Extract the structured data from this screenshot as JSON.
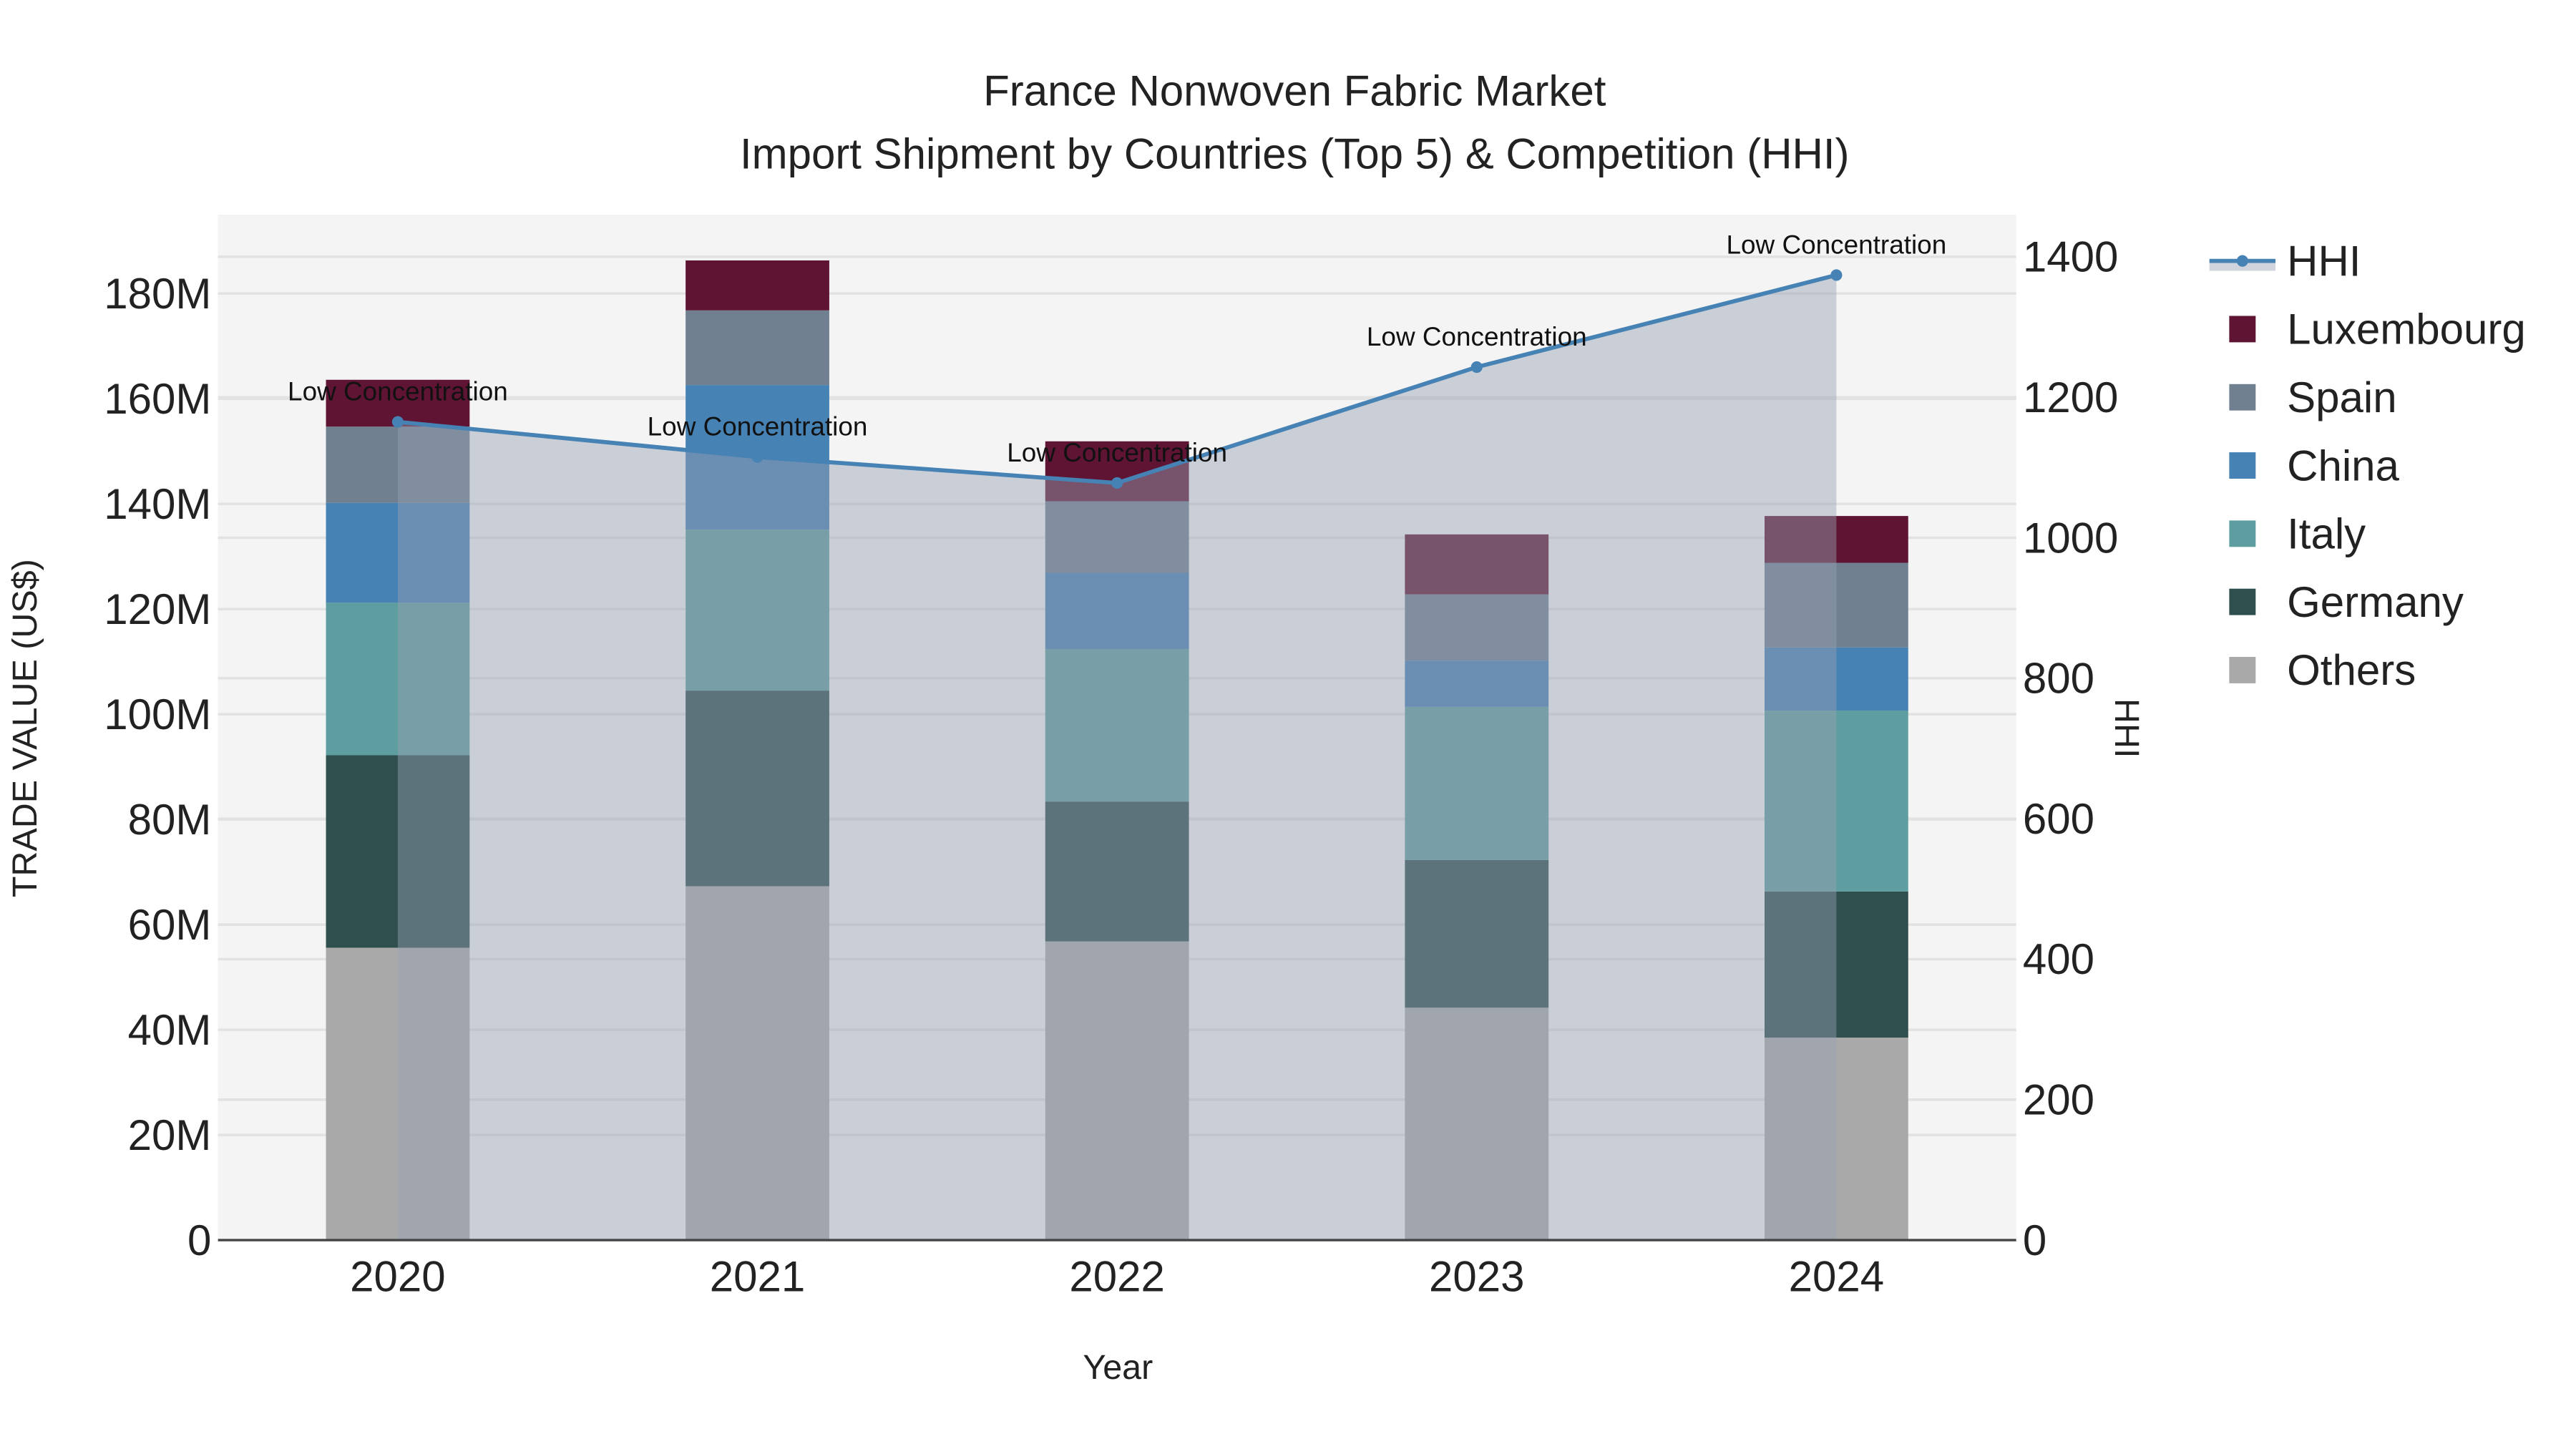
{
  "chart_data": {
    "type": "bar",
    "title": "France Nonwoven Fabric Market",
    "subtitle": "Import Shipment by Countries (Top 5) & Competition (HHI)",
    "xlabel": "Year",
    "ylabel": "TRADE VALUE (US$)",
    "y2label": "HHI",
    "categories": [
      "2020",
      "2021",
      "2022",
      "2023",
      "2024"
    ],
    "ylim": [
      0,
      195
    ],
    "yticks": [
      0,
      20,
      40,
      60,
      80,
      100,
      120,
      140,
      160,
      180
    ],
    "ytick_labels": [
      "0",
      "20M",
      "40M",
      "60M",
      "80M",
      "100M",
      "120M",
      "140M",
      "160M",
      "180M"
    ],
    "y2lim": [
      0,
      1460
    ],
    "y2ticks": [
      0,
      200,
      400,
      600,
      800,
      1000,
      1200,
      1400
    ],
    "y2tick_labels": [
      "0",
      "200",
      "400",
      "600",
      "800",
      "1000",
      "1200",
      "1400"
    ],
    "unit": "million US$",
    "series": [
      {
        "name": "Others",
        "color": "#a9a9a9",
        "values": [
          55.6,
          67.3,
          56.8,
          44.2,
          38.5
        ]
      },
      {
        "name": "Germany",
        "color": "#2f4f4f",
        "values": [
          36.6,
          37.2,
          26.6,
          28.1,
          27.8
        ]
      },
      {
        "name": "Italy",
        "color": "#5f9ea0",
        "values": [
          29.0,
          30.6,
          29.0,
          29.1,
          34.4
        ]
      },
      {
        "name": "China",
        "color": "#4682b4",
        "values": [
          19.0,
          27.5,
          14.5,
          8.8,
          12.0
        ]
      },
      {
        "name": "Spain",
        "color": "#708090",
        "values": [
          14.5,
          14.2,
          13.6,
          12.6,
          16.1
        ]
      },
      {
        "name": "Luxembourg",
        "color": "#5f1434",
        "values": [
          8.9,
          9.5,
          11.4,
          11.4,
          8.9
        ]
      }
    ],
    "hhi": {
      "name": "HHI",
      "color": "#4682b4",
      "values": [
        1165,
        1115,
        1078,
        1243,
        1374
      ]
    },
    "annotations": [
      "Low Concentration",
      "Low Concentration",
      "Low Concentration",
      "Low Concentration",
      "Low Concentration"
    ],
    "legend": [
      "HHI",
      "Luxembourg",
      "Spain",
      "China",
      "Italy",
      "Germany",
      "Others"
    ],
    "legend_position": "right",
    "grid": true
  }
}
